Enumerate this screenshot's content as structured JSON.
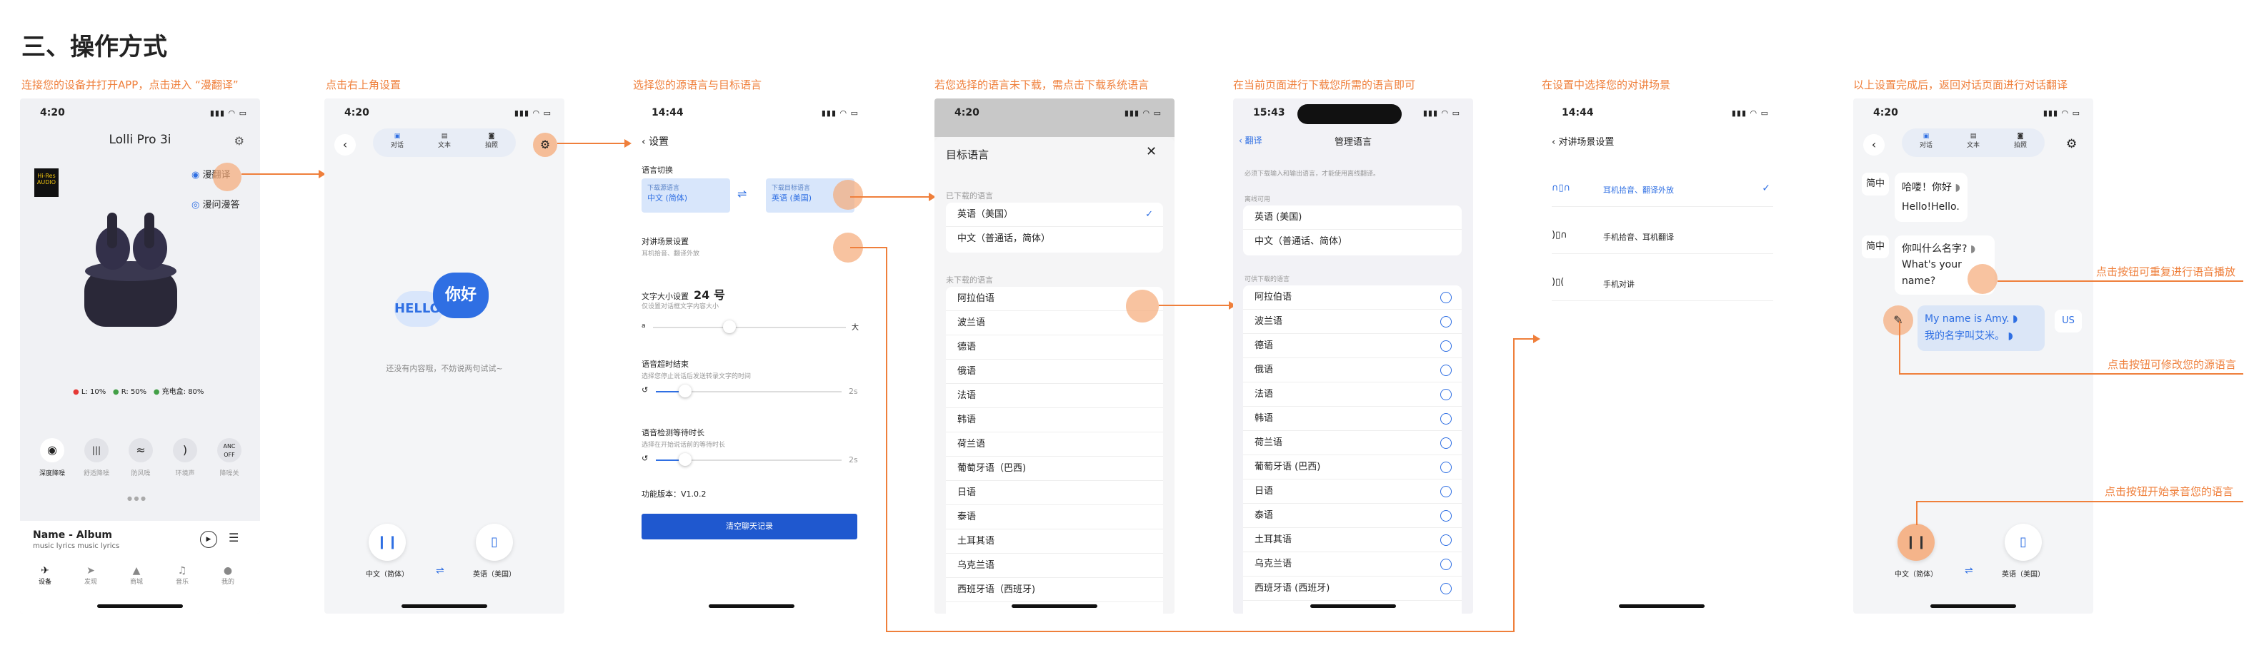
{
  "heading": "三、操作方式",
  "steps": [
    "连接您的设备并打开APP，点击进入 “漫翻译”",
    "点击右上角设置",
    "选择您的源语言与目标语言",
    "若您选择的语言未下载，需点击下载系统语言",
    "在当前页面进行下载您所需的语言即可",
    "在设置中选择您的对讲场景",
    "以上设置完成后，返回对话页面进行对话翻译"
  ],
  "p1": {
    "time": "4:20",
    "status_icons": "▮▮▮ ◠ ▭",
    "title": "Lolli Pro 3i",
    "hires": "Hi-Res AUDIO",
    "menu1": "漫翻译",
    "menu2": "漫问漫答",
    "stats": [
      "L: 10%",
      "R: 50%",
      "充电盒: 80%"
    ],
    "stat_colors": [
      "#e53935",
      "#43a047",
      "#43a047"
    ],
    "modes": [
      "深度降噪",
      "舒适降噪",
      "防风噪",
      "环境声",
      "降噪关"
    ],
    "anc": "ANC OFF",
    "album_title": "Name - Album",
    "album_sub": "music lyrics music lyrics",
    "nav": [
      "设备",
      "发现",
      "商城",
      "音乐",
      "我的"
    ]
  },
  "p2": {
    "time": "4:20",
    "tabs": [
      "对话",
      "文本",
      "拍照"
    ],
    "hello": "HELLO!",
    "nihao": "你好",
    "empty": "还没有内容哦，不妨说两句试试~",
    "left_lang": "中文（简体）",
    "right_lang": "英语（美国）"
  },
  "p3": {
    "time": "14:44",
    "title": "设置",
    "switch_label": "语言切换",
    "src_label": "下载源语言",
    "src_val": "中文 (简体)",
    "dst_label": "下载目标语言",
    "dst_val": "英语 (美国)",
    "scene_title": "对讲场景设置",
    "scene_sub": "耳机拾音、翻译外放",
    "font_title": "文字大小设置",
    "font_val": "24 号",
    "font_sub": "仅设置对话框文字内容大小",
    "font_min": "a",
    "font_max": "大",
    "timeout_title": "语音超时结束",
    "timeout_sub": "选择您停止说话后发送转录文字的时间",
    "timeout_val": "2s",
    "wait_title": "语音检测等待时长",
    "wait_sub": "选择在开始说话前的等待时长",
    "wait_val": "2s",
    "version": "功能版本：V1.0.2",
    "clear_btn": "清空聊天记录"
  },
  "p4": {
    "time": "4:20",
    "title": "目标语言",
    "downloaded": "已下载的语言",
    "dl_items": [
      "英语（美国）",
      "中文（普通话，简体）"
    ],
    "not_dl": "未下载的语言",
    "items": [
      "阿拉伯语",
      "波兰语",
      "德语",
      "俄语",
      "法语",
      "韩语",
      "荷兰语",
      "葡萄牙语（巴西)",
      "日语",
      "泰语",
      "土耳其语",
      "乌克兰语",
      "西班牙语（西班牙)"
    ]
  },
  "p5": {
    "time": "15:43",
    "back": "翻译",
    "title": "管理语言",
    "note": "必须下载输入和输出语言，才能使用离线翻译。",
    "avail": "离线可用",
    "avail_items": [
      "英语 (美国)",
      "中文（普通话、简体）"
    ],
    "download_label": "可供下载的语言",
    "items": [
      "阿拉伯语",
      "波兰语",
      "德语",
      "俄语",
      "法语",
      "韩语",
      "荷兰语",
      "葡萄牙语 (巴西)",
      "日语",
      "泰语",
      "土耳其语",
      "乌克兰语",
      "西班牙语 (西班牙)"
    ]
  },
  "p6": {
    "time": "14:44",
    "title": "对讲场景设置",
    "options": [
      "耳机拾音、翻译外放",
      "手机拾音、耳机翻译",
      "手机对讲"
    ]
  },
  "p7": {
    "time": "4:20",
    "tabs": [
      "对话",
      "文本",
      "拍照"
    ],
    "tag_cn": "简中",
    "tag_us": "US",
    "msg1": "哈喽！你好",
    "msg1b": "Hello!Hello.",
    "msg2": "你叫什么名字?",
    "msg2b": "What's your name?",
    "msg3": "My name is Amy.",
    "msg3b": "我的名字叫艾米。",
    "left_lang": "中文（简体）",
    "right_lang": "英语（美国）"
  },
  "annotations": [
    "点击按钮可重复进行语音播放",
    "点击按钮可修改您的源语言",
    "点击按钮开始录音您的语言"
  ],
  "colors": {
    "accent": "#ef7f3b",
    "blue": "#2f6fe3"
  }
}
